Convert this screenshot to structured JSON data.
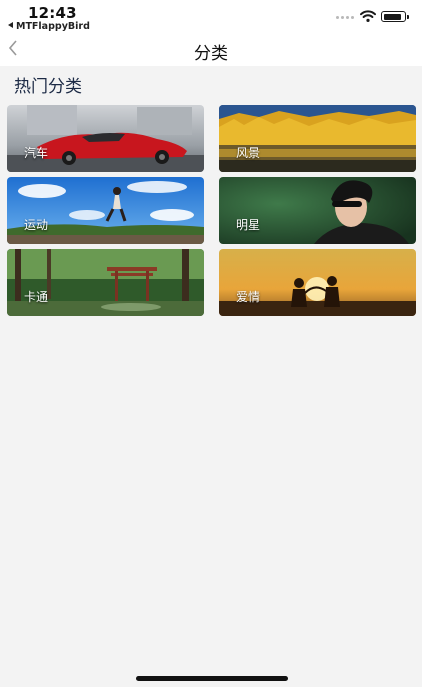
{
  "status_bar": {
    "time": "12:43",
    "back_app_label": "MTFlappyBird",
    "icons": [
      "signal-dots-icon",
      "wifi-icon",
      "battery-icon"
    ]
  },
  "nav": {
    "back_icon": "chevron-left-icon",
    "title": "分类"
  },
  "section": {
    "title": "热门分类"
  },
  "categories": [
    {
      "label": "汽车",
      "image": "red-sports-car"
    },
    {
      "label": "风景",
      "image": "autumn-lake-landscape"
    },
    {
      "label": "运动",
      "image": "runner-under-blue-sky"
    },
    {
      "label": "明星",
      "image": "person-with-sunglasses"
    },
    {
      "label": "卡通",
      "image": "anime-forest-shrine"
    },
    {
      "label": "爱情",
      "image": "couple-silhouette-sunset"
    }
  ],
  "colors": {
    "background": "#f3f3f3",
    "bar_background": "#ffffff",
    "section_title": "#1c2a45"
  }
}
